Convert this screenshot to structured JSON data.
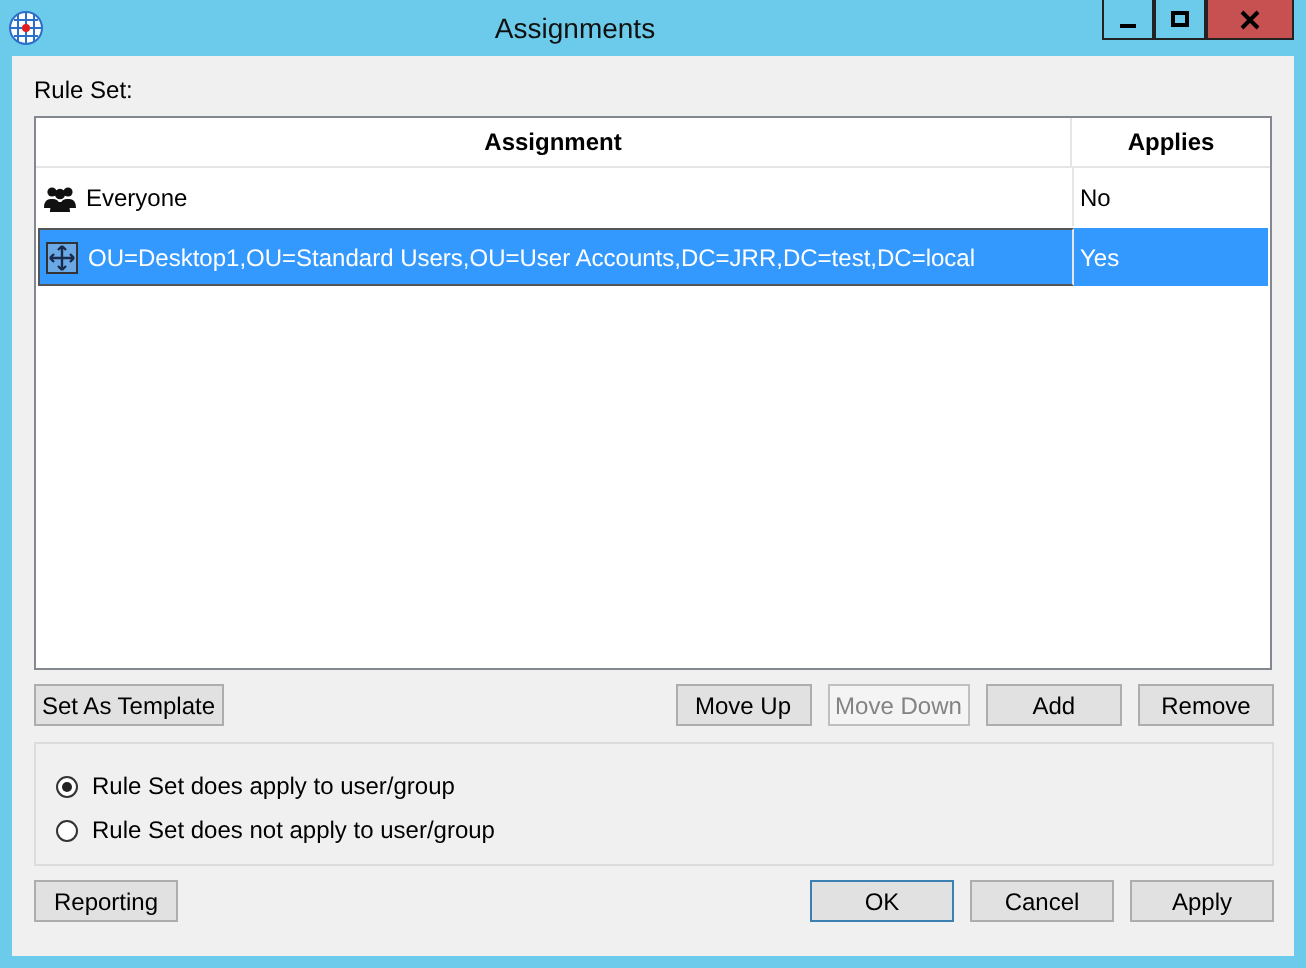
{
  "window": {
    "title": "Assignments"
  },
  "rule_set_label": "Rule Set:",
  "table": {
    "columns": [
      "Assignment",
      "Applies"
    ],
    "rows": [
      {
        "kind": "group",
        "assignment": "Everyone",
        "applies": "No",
        "selected": false
      },
      {
        "kind": "ou",
        "assignment": "OU=Desktop1,OU=Standard Users,OU=User Accounts,DC=JRR,DC=test,DC=local",
        "applies": "Yes",
        "selected": true
      }
    ]
  },
  "list_buttons": [
    {
      "label": "Set As Template",
      "disabled": false
    },
    {
      "label": "Move Up",
      "disabled": false
    },
    {
      "label": "Move Down",
      "disabled": true
    },
    {
      "label": "Add",
      "disabled": false
    },
    {
      "label": "Remove",
      "disabled": false
    }
  ],
  "options": [
    {
      "label": "Rule Set does apply to user/group",
      "selected": true
    },
    {
      "label": "Rule Set does not apply to user/group",
      "selected": false
    }
  ],
  "dialog_buttons": [
    {
      "label": "Reporting",
      "default": false
    },
    {
      "label": "OK",
      "default": true
    },
    {
      "label": "Cancel",
      "default": false
    },
    {
      "label": "Apply",
      "default": false
    }
  ]
}
